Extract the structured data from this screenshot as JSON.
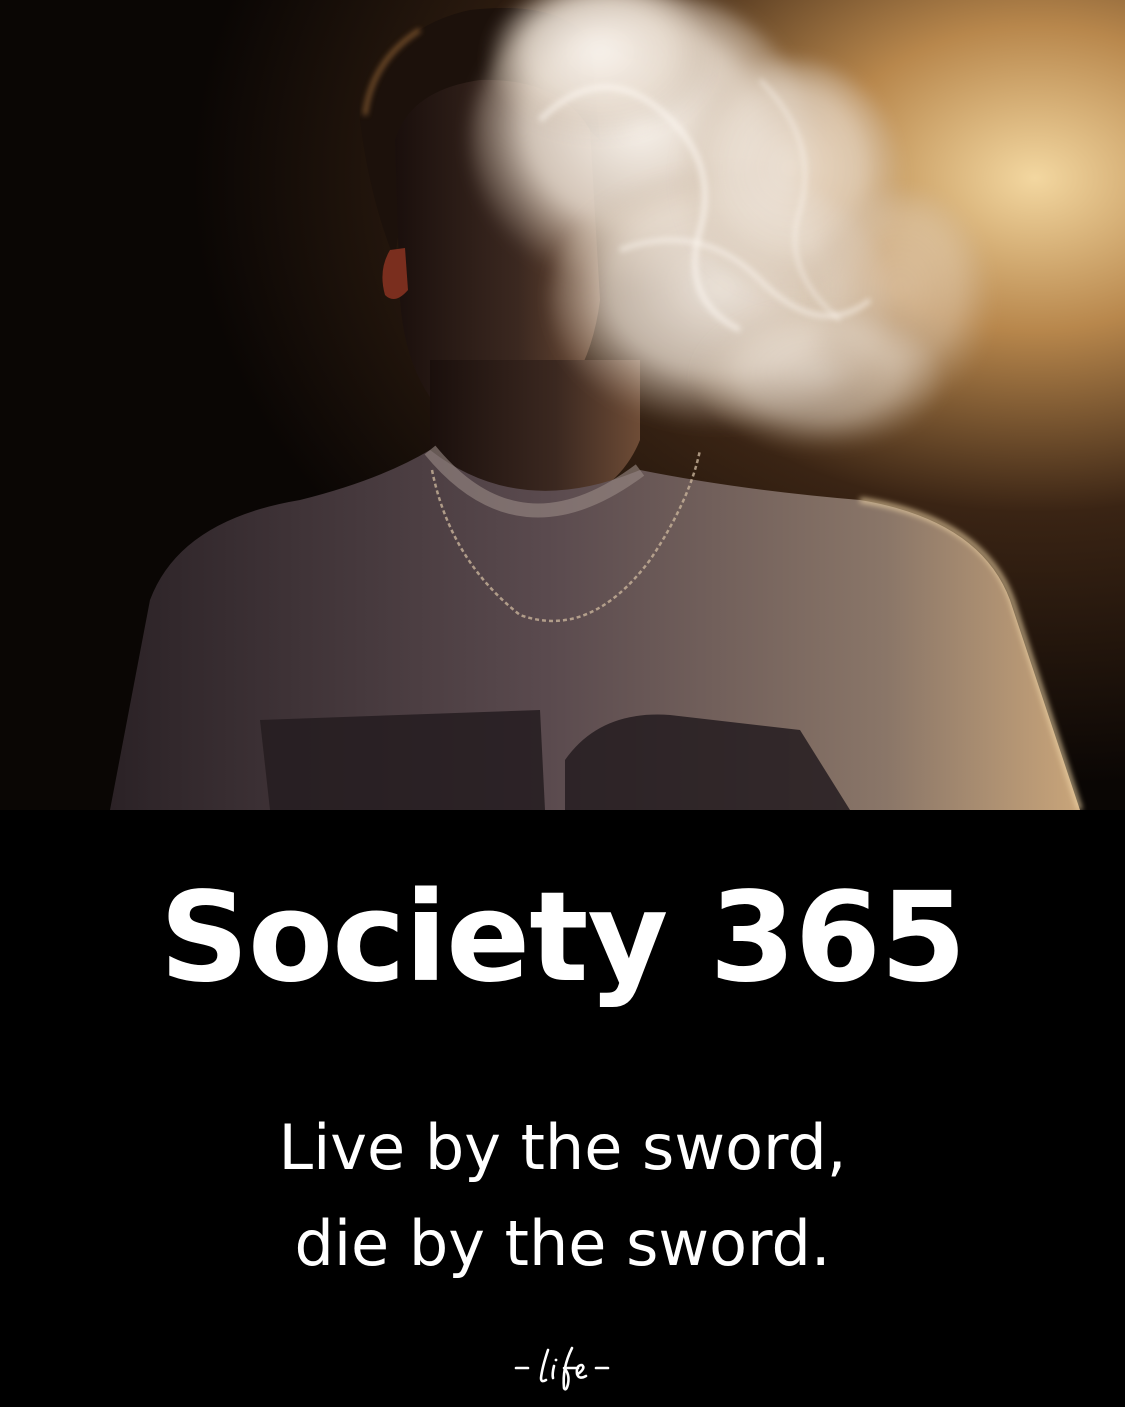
{
  "poster": {
    "title": "Society 365",
    "quote_line_1": "Live by the sword,",
    "quote_line_2": "die by the sword.",
    "signature_logo": "-Life-"
  },
  "colors": {
    "panel_background": "#000000",
    "text": "#ffffff",
    "backlight": "#e8c48a",
    "smoke": "#f2ece6"
  },
  "photo": {
    "subject": "silhouetted-person-exhaling-smoke",
    "icons": [
      "smoke-cloud",
      "chain-necklace"
    ]
  }
}
